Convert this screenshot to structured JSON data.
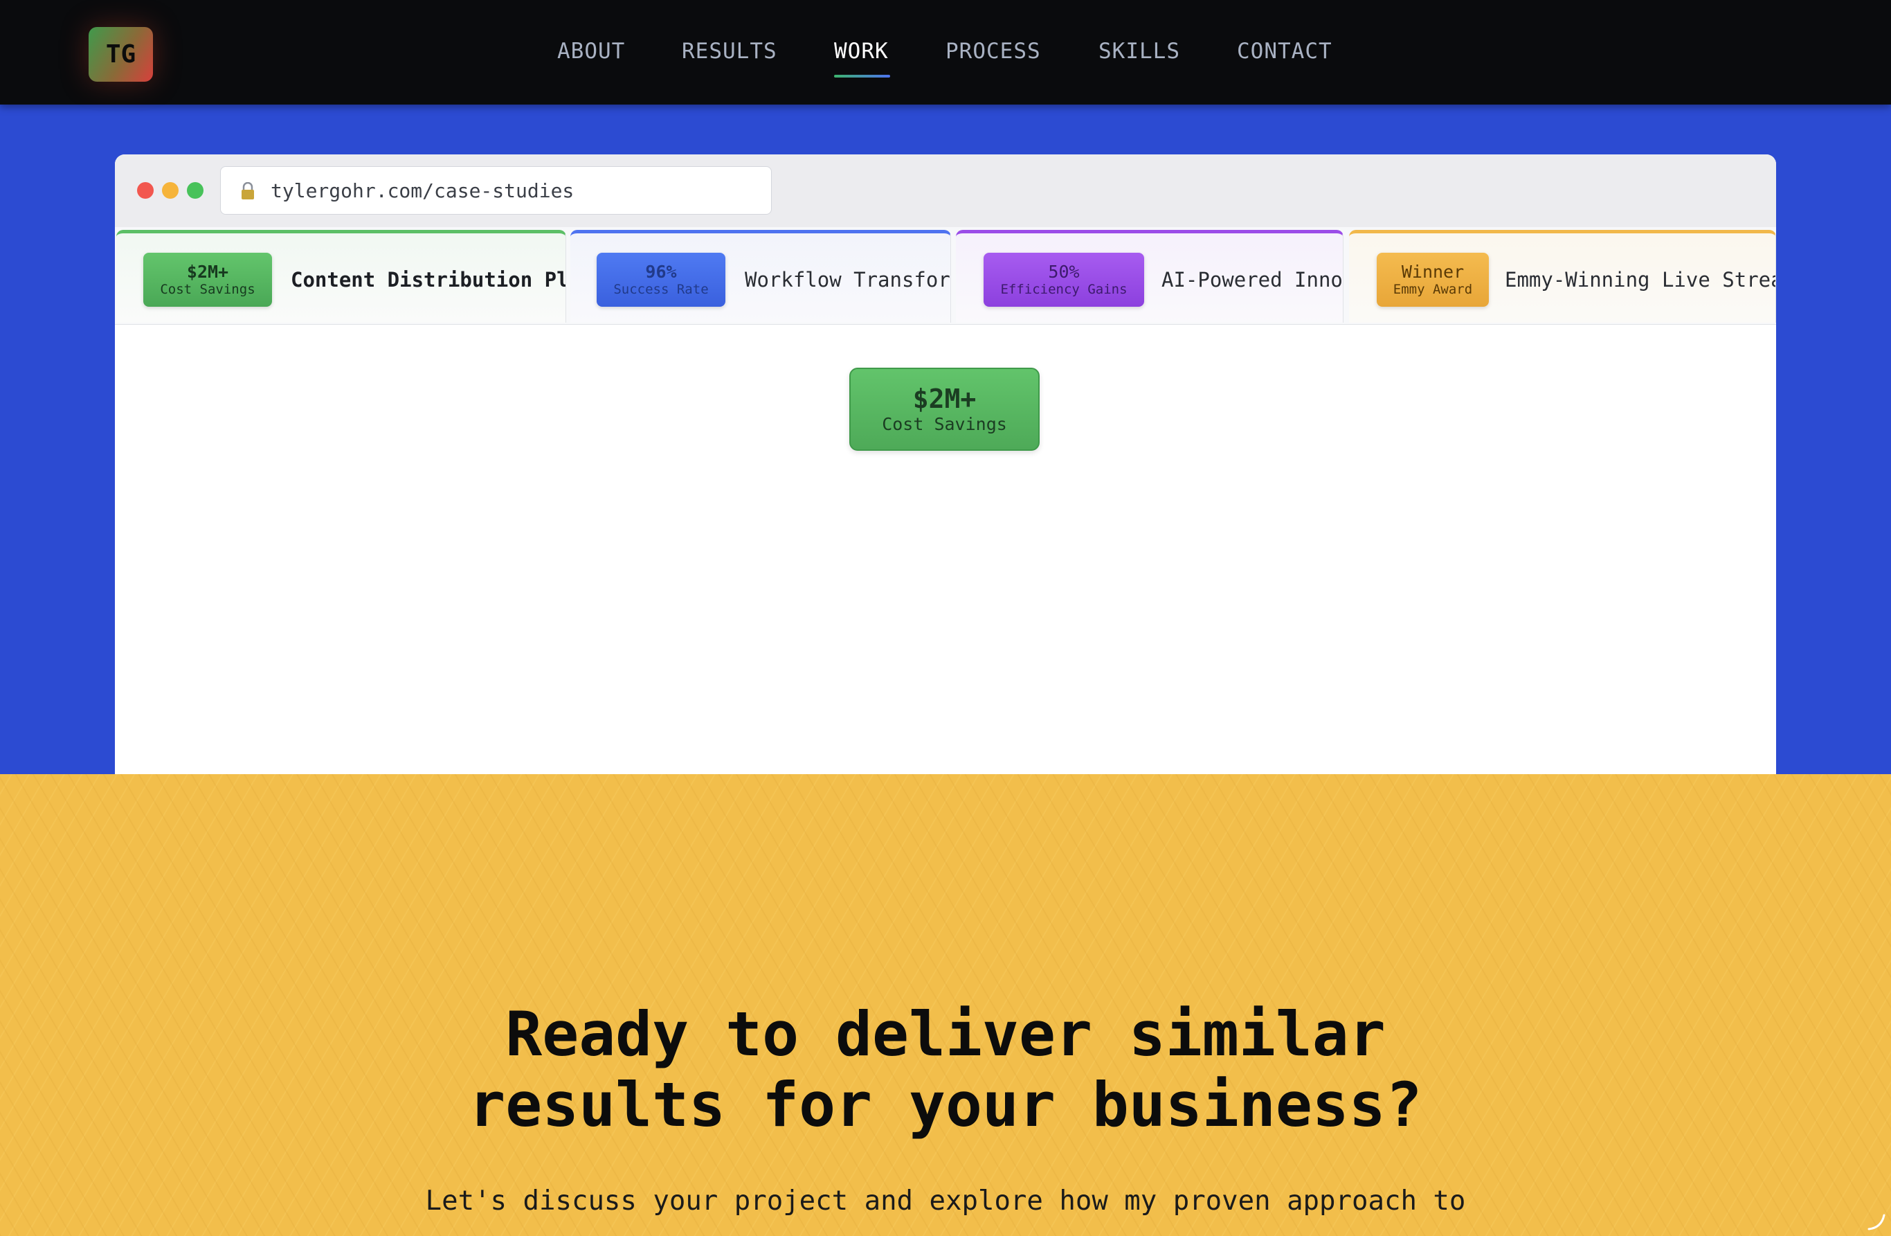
{
  "nav": {
    "logo": "TG",
    "items": [
      {
        "label": "ABOUT"
      },
      {
        "label": "RESULTS"
      },
      {
        "label": "WORK",
        "active": true
      },
      {
        "label": "PROCESS"
      },
      {
        "label": "SKILLS"
      },
      {
        "label": "CONTACT"
      }
    ]
  },
  "browser": {
    "url": "tylergohr.com/case-studies",
    "tabs": [
      {
        "badge_value": "$2M+",
        "badge_label": "Cost Savings",
        "title": "Content Distribution Platform Revolution",
        "color": "#5cbf66"
      },
      {
        "badge_value": "96%",
        "badge_label": "Success Rate",
        "title": "Workflow Transformation",
        "color": "#4e73f0"
      },
      {
        "badge_value": "50%",
        "badge_label": "Efficiency Gains",
        "title": "AI-Powered Innovation",
        "color": "#9b4de8"
      },
      {
        "badge_value": "Winner",
        "badge_label": "Emmy Award",
        "title": "Emmy-Winning Live Streaming",
        "color": "#f1b84a"
      }
    ],
    "featured": {
      "value": "$2M+",
      "label": "Cost Savings"
    }
  },
  "cta": {
    "title_line1": "Ready to deliver similar",
    "title_line2": "results for your business?",
    "subtitle": "Let's discuss your project and explore how my proven approach to"
  }
}
